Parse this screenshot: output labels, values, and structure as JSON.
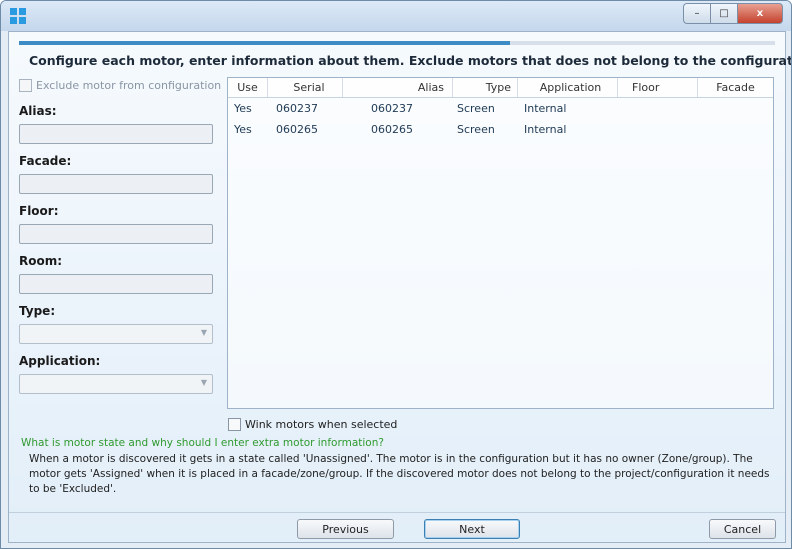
{
  "window": {
    "controls": {
      "minimize": "–",
      "maximize": "□",
      "close": "x"
    }
  },
  "progress": {
    "fraction": 0.65
  },
  "instruction": "Configure each motor, enter information about them. Exclude motors that does not belong to the configuration.",
  "left_panel": {
    "exclude_label": "Exclude motor from configuration",
    "alias_label": "Alias:",
    "facade_label": "Facade:",
    "floor_label": "Floor:",
    "room_label": "Room:",
    "type_label": "Type:",
    "application_label": "Application:"
  },
  "grid": {
    "columns": [
      "Use",
      "Serial",
      "Alias",
      "Type",
      "Application",
      "Floor",
      "Facade"
    ],
    "rows": [
      {
        "use": "Yes",
        "serial": "060237",
        "alias": "060237",
        "type": "Screen",
        "application": "Internal",
        "floor": "",
        "facade": ""
      },
      {
        "use": "Yes",
        "serial": "060265",
        "alias": "060265",
        "type": "Screen",
        "application": "Internal",
        "floor": "",
        "facade": ""
      }
    ]
  },
  "wink_label": "Wink motors when selected",
  "help": {
    "link": "What is motor state and why should I enter extra motor information?",
    "text": "When a motor is discovered it gets in a state called 'Unassigned'. The motor is in the configuration but it has no owner (Zone/group). The motor gets 'Assigned' when it is placed in a facade/zone/group. If the discovered motor does not belong to the project/configuration it needs to be 'Excluded'."
  },
  "buttons": {
    "previous": "Previous",
    "next": "Next",
    "cancel": "Cancel"
  },
  "colors": {
    "accent": "#3e8cc6",
    "help_link": "#2f9a2f",
    "close_button": "#c4422e"
  }
}
